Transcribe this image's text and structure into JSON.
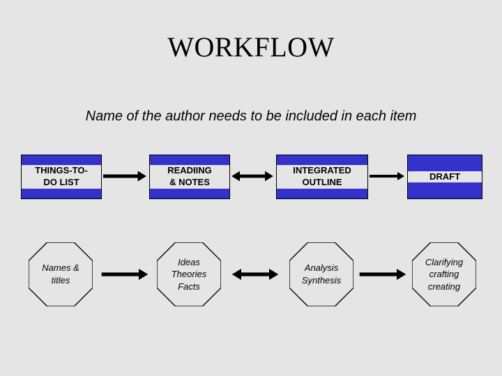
{
  "title": "WORKFLOW",
  "subtitle": "Name of the author needs to be included in each item",
  "boxes": {
    "b1": "THINGS-TO-\nDO LIST",
    "b2": "READIING\n& NOTES",
    "b3": "INTEGRATED\nOUTLINE",
    "b4": "DRAFT"
  },
  "octagons": {
    "o1": "Names &\ntitles",
    "o2": "Ideas\nTheories\nFacts",
    "o3": "Analysis\nSynthesis",
    "o4": "Clarifying\ncrafting\ncreating"
  }
}
